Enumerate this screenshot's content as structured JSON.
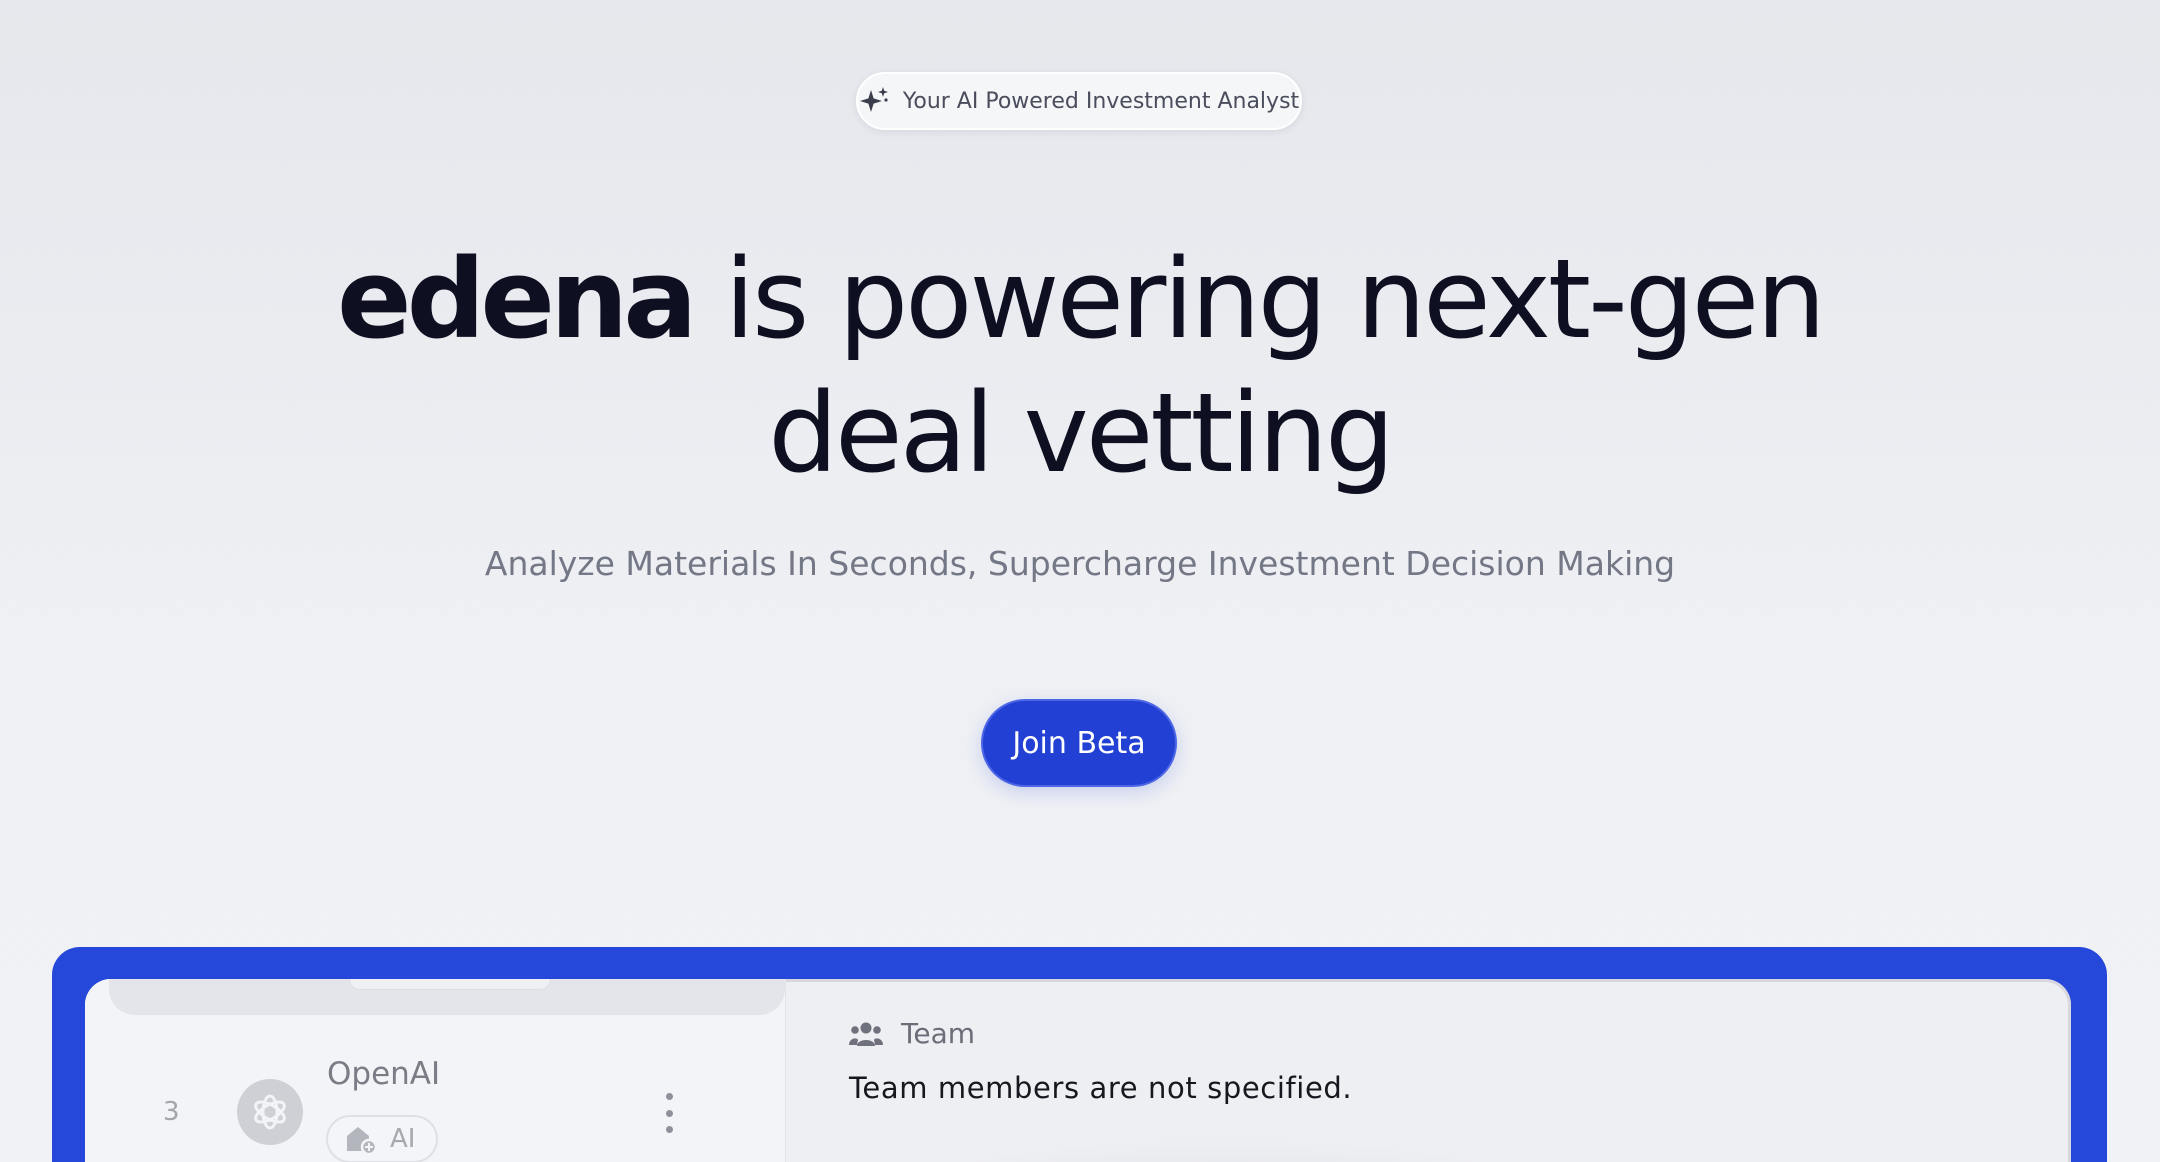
{
  "hero": {
    "badge_text": "Your AI Powered Investment Analyst",
    "badge_icon": "sparkle-icon",
    "title_brand": "edena",
    "title_rest": " is powering next-gen deal vetting",
    "subtitle": "Analyze Materials In Seconds, Supercharge Investment Decision Making",
    "cta_label": "Join Beta"
  },
  "colors": {
    "accent": "#2241d4",
    "frame": "#2548db",
    "text_dark": "#0e1021",
    "text_muted": "#747785"
  },
  "preview": {
    "list_row": {
      "index": "3",
      "company_name": "OpenAI",
      "logo_icon": "openai-logo-icon",
      "tag_label": "AI",
      "tag_icon": "category-icon",
      "menu_icon": "kebab-menu-icon"
    },
    "panel": {
      "icon": "team-icon",
      "title": "Team",
      "body": "Team members are not specified."
    }
  }
}
